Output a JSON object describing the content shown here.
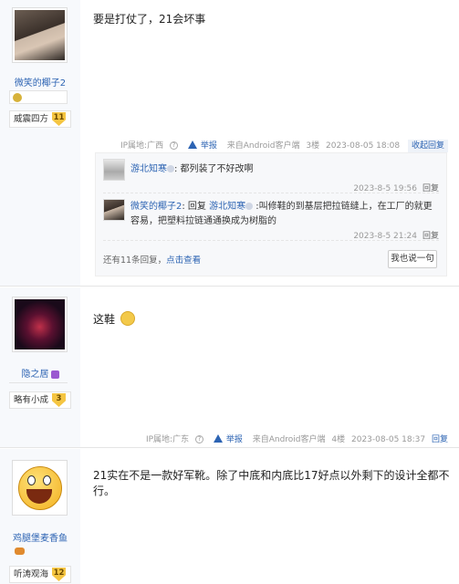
{
  "posts": [
    {
      "username": "微笑的椰子2",
      "level_title": "威震四方",
      "level": "11",
      "content": "要是打仗了，21会坏事",
      "ip": "IP属地:广西",
      "report": "举报",
      "source": "来自Android客户端",
      "floor": "3楼",
      "time": "2023-08-05 18:08",
      "reply": "收起回复",
      "sub_replies": [
        {
          "name": "游北知寒",
          "text": ": 都列装了不好改啊",
          "time": "2023-8-5 19:56",
          "reply": "回复"
        },
        {
          "name": "微笑的椰子2",
          "prefix": ": 回复 ",
          "target": "游北知寒",
          "text": " :叫修鞋的到基层把拉链缝上，在工厂的就更容易，把塑料拉链通通换成为树脂的",
          "time": "2023-8-5 21:24",
          "reply": "回复"
        }
      ],
      "more_text": "还有11条回复，",
      "more_link": "点击查看",
      "say_button": "我也说一句"
    },
    {
      "username": "隐之居",
      "level_title": "略有小成",
      "level": "3",
      "content": "这鞋",
      "ip": "IP属地:广东",
      "report": "举报",
      "source": "来自Android客户端",
      "floor": "4楼",
      "time": "2023-08-05 18:37",
      "reply": "回复"
    },
    {
      "username": "鸡腿堡麦香鱼",
      "level_title": "听涛观海",
      "level": "12",
      "content": "21实在不是一款好军靴。除了中底和内底比17好点以外剩下的设计全都不行。"
    }
  ],
  "colors": {
    "link": "#2d64b3",
    "sidebar": "#f7f9fc",
    "level_badge": "#f5c542"
  }
}
